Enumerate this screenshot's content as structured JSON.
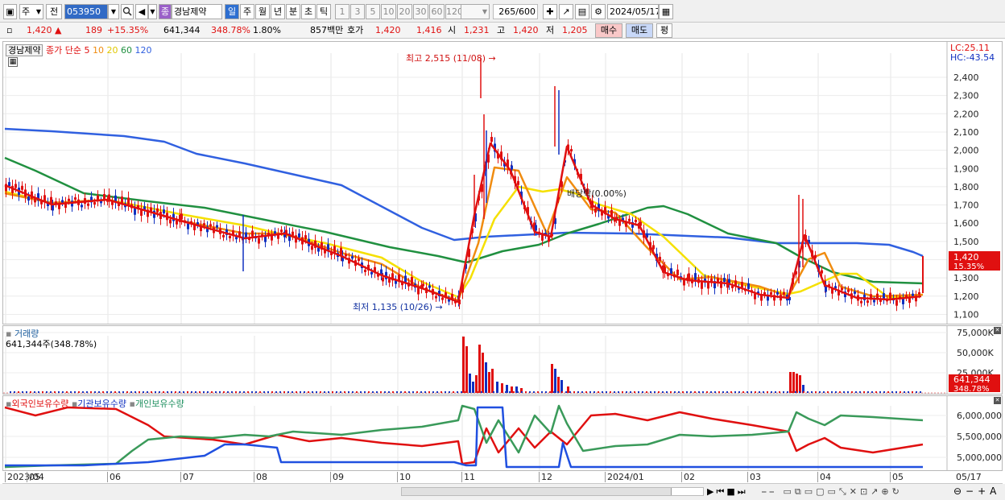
{
  "toolbar": {
    "mode_label": "주",
    "prev_label": "전",
    "code_value": "053950",
    "stock_tag": "종",
    "stock_name": "경남제약",
    "periods": [
      "일",
      "주",
      "월",
      "년",
      "분",
      "초",
      "틱"
    ],
    "numbers": [
      "1",
      "3",
      "5",
      "10",
      "20",
      "30",
      "60",
      "120"
    ],
    "count_value": "265",
    "count_total": "/600",
    "date_value": "2024/05/17"
  },
  "quote": {
    "price": "1,420",
    "change": "189",
    "change_pct": "+15.35%",
    "volume": "641,344",
    "volume_pct": "348.78%",
    "turnover": "1.80%",
    "amount": "857백만",
    "bid_ask_label": "호가",
    "bid": "1,420",
    "ask": "1,416",
    "open_label": "시",
    "open": "1,231",
    "high_label": "고",
    "high": "1,420",
    "low_label": "저",
    "low": "1,205",
    "buy_label": "매수",
    "sell_label": "매도",
    "eval_label": "평"
  },
  "colors": {
    "up": "#e01010",
    "down": "#1030c0",
    "ma5": "#e01010",
    "ma10": "#f08c10",
    "ma20": "#f5e000",
    "ma60": "#209040",
    "ma120": "#3060e0"
  },
  "price_pane": {
    "name_tag": "경남제약",
    "legend_label": "종가 단순",
    "ma_periods": [
      "5",
      "10",
      "20",
      "60",
      "120"
    ],
    "lc": "LC:25.11",
    "hc": "HC:-43.54",
    "y_ticks": [
      "2,400",
      "2,300",
      "2,200",
      "2,100",
      "2,000",
      "1,900",
      "1,800",
      "1,700",
      "1,600",
      "1,500",
      "1,400",
      "1,300",
      "1,200",
      "1,100"
    ],
    "current_price": "1,420",
    "current_pct": "15.35%",
    "high_annotation": "최고 2,515 (11/08)",
    "low_annotation": "최저 1,135 (10/26)",
    "event_annotation": "배당락(0.00%)"
  },
  "volume_pane": {
    "title": "거래량",
    "value_text": "641,344주(348.78%)",
    "y_ticks": [
      "75,000K",
      "50,000K",
      "25,000K"
    ],
    "current": "641,344",
    "current_pct": "348.78%"
  },
  "holding_pane": {
    "legend": [
      "외국인보유수량",
      "기관보유수량",
      "개인보유수량"
    ],
    "y_ticks": [
      "6,000,000",
      "5,500,000",
      "5,000,000"
    ]
  },
  "x_axis": [
    "2023/04",
    "05",
    "06",
    "07",
    "08",
    "09",
    "10",
    "11",
    "12",
    "2024/01",
    "02",
    "03",
    "04",
    "05"
  ],
  "x_last": "05/17"
}
